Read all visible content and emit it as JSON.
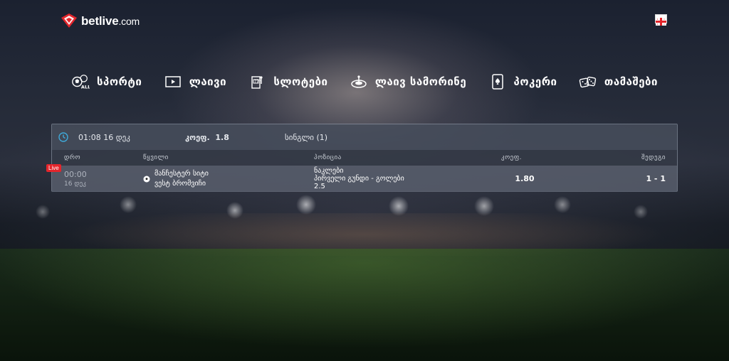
{
  "brand": {
    "name": "betlive",
    "suffix": ".com",
    "accent": "#e4252b"
  },
  "language_flag": "georgia-flag-icon",
  "nav": [
    {
      "label": "სპორტი",
      "icon": "sports-all-icon"
    },
    {
      "label": "ლაივი",
      "icon": "play-icon"
    },
    {
      "label": "სლოტები",
      "icon": "slot-machine-icon"
    },
    {
      "label": "ლაივ სამორინე",
      "icon": "roulette-icon"
    },
    {
      "label": "პოკერი",
      "icon": "playing-card-icon"
    },
    {
      "label": "თამაშები",
      "icon": "dice-icon"
    }
  ],
  "betslip": {
    "datetime": "01:08 16 დეკ",
    "odds_label": "კოეფ.",
    "odds_value": "1.8",
    "type": "სინგლი (1)",
    "headers": {
      "time": "დრო",
      "event": "წყვილი",
      "market": "პოზიცია",
      "odds": "კოეფ.",
      "score": "შედეგი"
    },
    "rows": [
      {
        "badge": "Live",
        "time": "00:00",
        "date": "16 დეკ",
        "home": "მანჩესტერ სიტი",
        "away": "ვესტ ბრომვიჩი",
        "market_line1": "ნაკლები",
        "market_line2": "პირველი გუნდი - გოლები",
        "market_line3": "2.5",
        "odds": "1.80",
        "score": "1 - 1"
      }
    ]
  }
}
